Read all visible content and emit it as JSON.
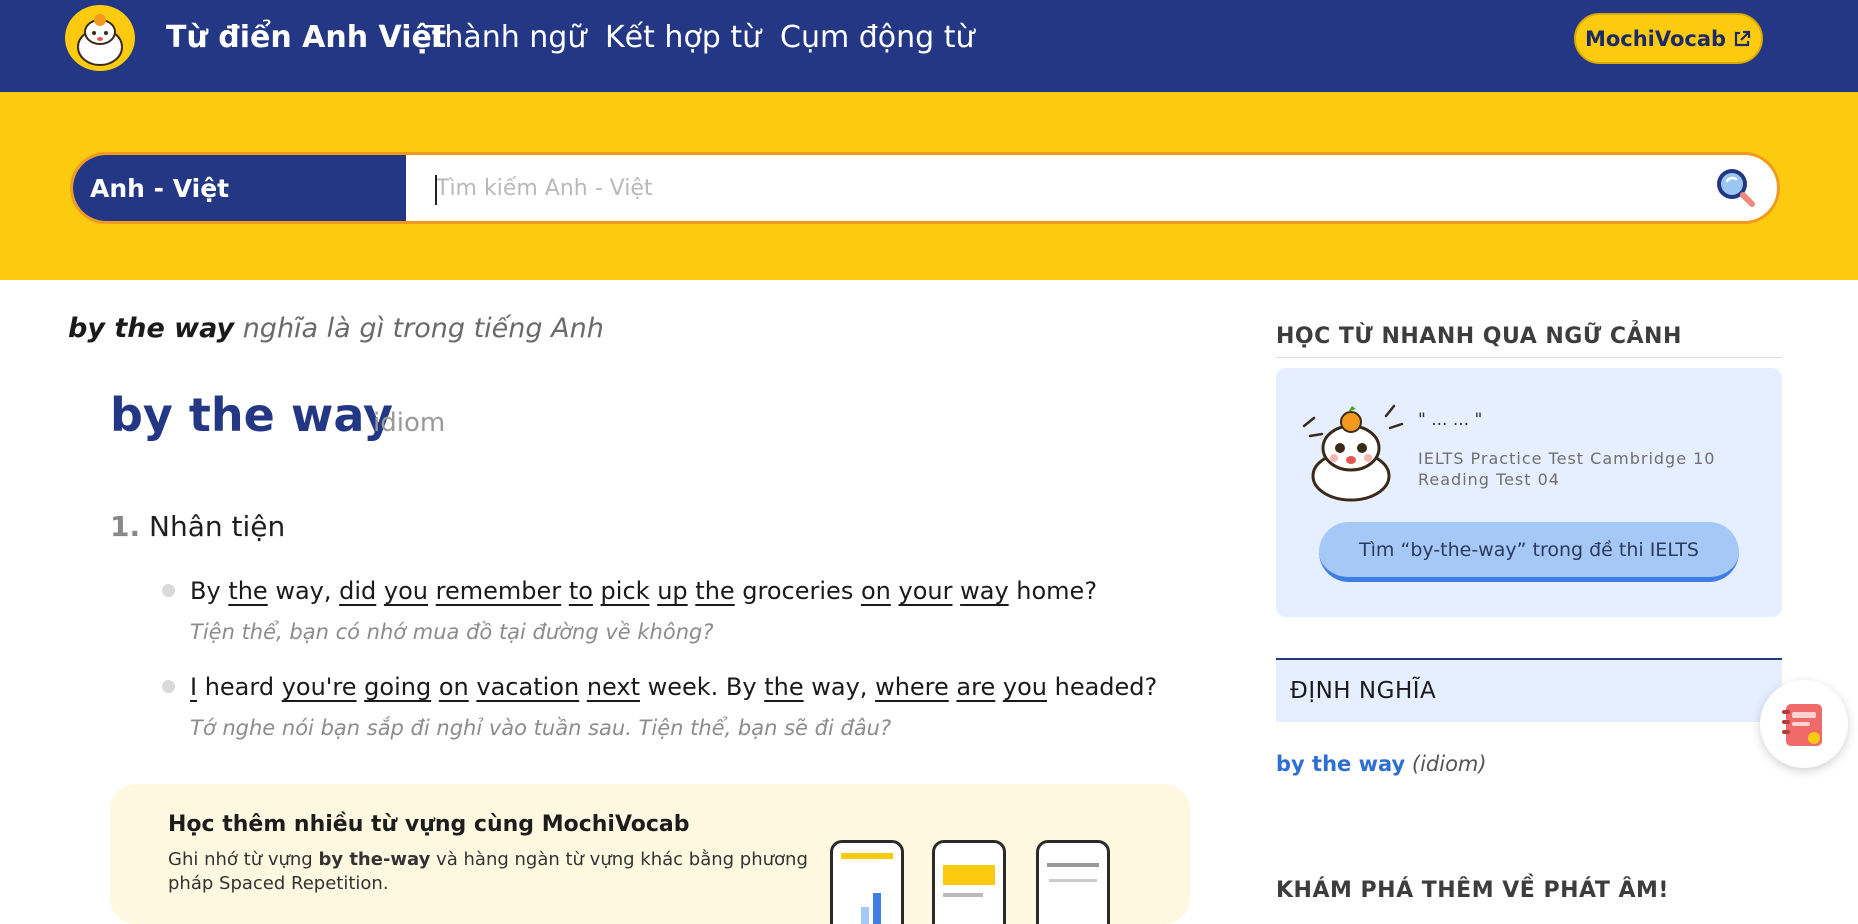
{
  "nav": {
    "brand": "Từ điển Anh Việt",
    "links": [
      "Thành ngữ",
      "Kết hợp từ",
      "Cụm động từ"
    ],
    "mochivocab_label": "MochiVocab"
  },
  "search": {
    "language_label": "Anh - Việt",
    "placeholder": "Tìm kiếm Anh - Việt",
    "value": ""
  },
  "entry": {
    "heading_word": "by the way",
    "heading_suffix": " nghĩa là gì trong tiếng Anh",
    "word": "by the way",
    "pos": "idiom",
    "sense_number": "1.",
    "sense_meaning": "Nhân tiện",
    "examples": [
      {
        "tokens": [
          {
            "t": "By",
            "u": false
          },
          {
            "t": " ",
            "u": false
          },
          {
            "t": "the",
            "u": true
          },
          {
            "t": " way, ",
            "u": false
          },
          {
            "t": "did",
            "u": true
          },
          {
            "t": " ",
            "u": false
          },
          {
            "t": "you",
            "u": true
          },
          {
            "t": " ",
            "u": false
          },
          {
            "t": "remember",
            "u": true
          },
          {
            "t": " ",
            "u": false
          },
          {
            "t": "to",
            "u": true
          },
          {
            "t": " ",
            "u": false
          },
          {
            "t": "pick",
            "u": true
          },
          {
            "t": " ",
            "u": false
          },
          {
            "t": "up",
            "u": true
          },
          {
            "t": " ",
            "u": false
          },
          {
            "t": "the",
            "u": true
          },
          {
            "t": " groceries ",
            "u": false
          },
          {
            "t": "on",
            "u": true
          },
          {
            "t": " ",
            "u": false
          },
          {
            "t": "your",
            "u": true
          },
          {
            "t": " ",
            "u": false
          },
          {
            "t": "way",
            "u": true
          },
          {
            "t": " home?",
            "u": false
          }
        ],
        "translation": "Tiện thể, bạn có nhớ mua đồ tại đường về không?"
      },
      {
        "tokens": [
          {
            "t": "I",
            "u": true
          },
          {
            "t": " heard ",
            "u": false
          },
          {
            "t": "you're",
            "u": true
          },
          {
            "t": " ",
            "u": false
          },
          {
            "t": "going",
            "u": true
          },
          {
            "t": " ",
            "u": false
          },
          {
            "t": "on",
            "u": true
          },
          {
            "t": " ",
            "u": false
          },
          {
            "t": "vacation",
            "u": true
          },
          {
            "t": " ",
            "u": false
          },
          {
            "t": "next",
            "u": true
          },
          {
            "t": " week. By ",
            "u": false
          },
          {
            "t": "the",
            "u": true
          },
          {
            "t": " way, ",
            "u": false
          },
          {
            "t": "where",
            "u": true
          },
          {
            "t": " ",
            "u": false
          },
          {
            "t": "are",
            "u": true
          },
          {
            "t": " ",
            "u": false
          },
          {
            "t": "you",
            "u": true
          },
          {
            "t": " headed?",
            "u": false
          }
        ],
        "translation": "Tớ nghe nói bạn sắp đi nghỉ vào tuần sau. Tiện thể, bạn sẽ đi đâu?"
      }
    ]
  },
  "promo": {
    "title": "Học thêm nhiều từ vựng cùng MochiVocab",
    "text_before": "Ghi nhớ từ vựng ",
    "text_bold": "by the-way",
    "text_after": " và hàng ngàn từ vựng khác bằng phương pháp Spaced Repetition."
  },
  "sidebar": {
    "context_heading": "HỌC TỪ NHANH QUA NGỮ CẢNH",
    "context_quote": "\" ... ... \"",
    "context_source": "IELTS Practice Test Cambridge 10 Reading Test 04",
    "context_button": "Tìm “by-the-way” trong đề thi IELTS",
    "definition_heading": "ĐỊNH NGHĨA",
    "definition_word": "by the way",
    "definition_pos": "(idiom)",
    "explore_heading": "KHÁM PHÁ THÊM VỀ PHÁT ÂM!"
  },
  "colors": {
    "navy": "#233785",
    "yellow": "#fccb10",
    "orange_border": "#f39a1e",
    "card_blue": "#e6efff",
    "button_blue": "#a6c8f7",
    "link_blue": "#2e6fd4",
    "promo_bg": "#fff8e1"
  }
}
